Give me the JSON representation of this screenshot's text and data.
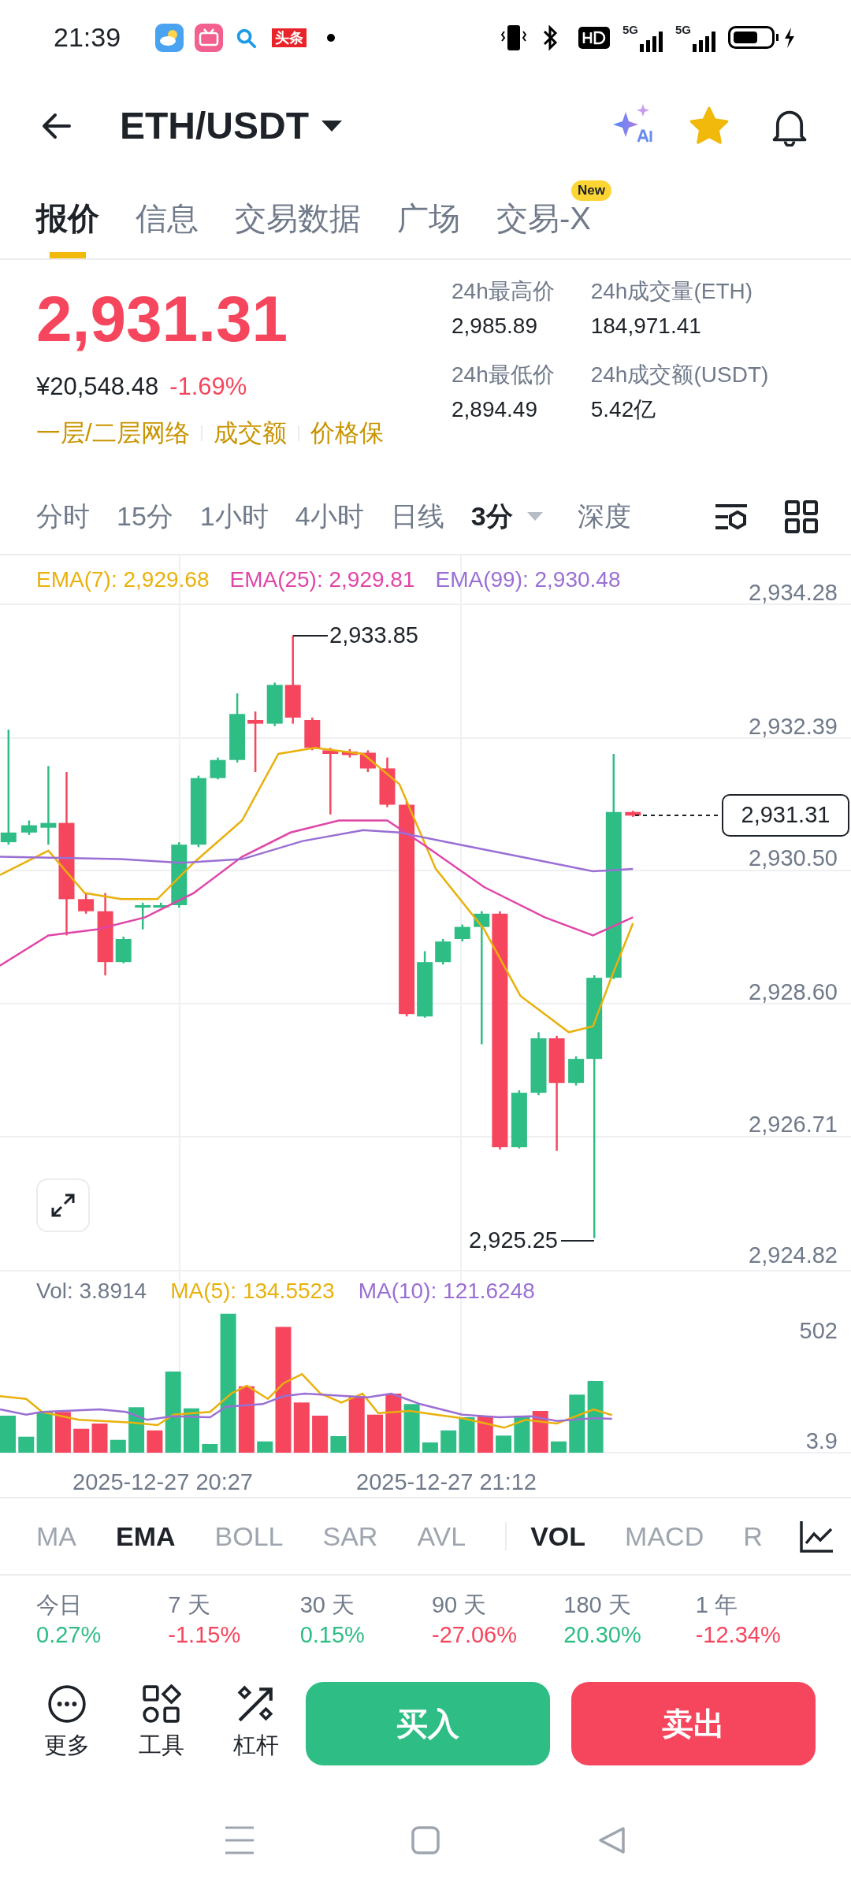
{
  "status_bar": {
    "time": "21:39",
    "news_app": "头条",
    "signals": [
      {
        "network": "5G"
      },
      {
        "network": "5G"
      }
    ]
  },
  "header": {
    "title": "ETH/USDT",
    "favorite": true
  },
  "tabs": [
    {
      "label": "报价",
      "selected": true
    },
    {
      "label": "信息",
      "selected": false
    },
    {
      "label": "交易数据",
      "selected": false
    },
    {
      "label": "广场",
      "selected": false
    },
    {
      "label": "交易-X",
      "selected": false,
      "badge": "New"
    }
  ],
  "price": {
    "last": "2,931.31",
    "fiat": "¥20,548.48",
    "change": "-1.69%",
    "color": "#f6465d",
    "links": [
      "一层/二层网络",
      "成交额",
      "价格保"
    ]
  },
  "stats": [
    {
      "label": "24h最高价",
      "value": "2,985.89"
    },
    {
      "label": "24h成交量(ETH)",
      "value": "184,971.41"
    },
    {
      "label": "24h最低价",
      "value": "2,894.49"
    },
    {
      "label": "24h成交额(USDT)",
      "value": "5.42亿"
    }
  ],
  "intervals": [
    {
      "label": "分时",
      "selected": false
    },
    {
      "label": "15分",
      "selected": false
    },
    {
      "label": "1小时",
      "selected": false
    },
    {
      "label": "4小时",
      "selected": false
    },
    {
      "label": "日线",
      "selected": false
    },
    {
      "label": "3分",
      "selected": true,
      "dropdown": true
    },
    {
      "label": "深度",
      "selected": false
    }
  ],
  "chart": {
    "legend": [
      {
        "text": "EMA(7): 2,929.68",
        "color": "#e8b10c"
      },
      {
        "text": "EMA(25): 2,929.81",
        "color": "#e045a8"
      },
      {
        "text": "EMA(99): 2,930.48",
        "color": "#9a6fd4"
      }
    ],
    "y_axis": [
      "2,934.28",
      "2,932.39",
      "2,930.50",
      "2,928.60",
      "2,926.71",
      "2,924.82"
    ],
    "high_label": "2,933.85",
    "low_label": "2,925.25",
    "last_price": "2,931.31"
  },
  "volume": {
    "legend": [
      {
        "text": "Vol: 3.8914",
        "color": "#707a8a"
      },
      {
        "text": "MA(5): 134.5523",
        "color": "#e8b10c"
      },
      {
        "text": "MA(10): 121.6248",
        "color": "#9a6fd4"
      }
    ],
    "y_axis": [
      "502",
      "3.9"
    ],
    "x_axis": [
      "2025-12-27 20:27",
      "2025-12-27 21:12"
    ]
  },
  "indicators": [
    {
      "label": "MA",
      "selected": false
    },
    {
      "label": "EMA",
      "selected": true
    },
    {
      "label": "BOLL",
      "selected": false
    },
    {
      "label": "SAR",
      "selected": false
    },
    {
      "label": "AVL",
      "selected": false
    },
    {
      "label": "VOL",
      "selected": true,
      "divider_before": true
    },
    {
      "label": "MACD",
      "selected": false
    },
    {
      "label": "R",
      "selected": false
    }
  ],
  "returns": [
    {
      "period": "今日",
      "value": "0.27%",
      "color": "#2ebd85"
    },
    {
      "period": "7 天",
      "value": "-1.15%",
      "color": "#f6465d"
    },
    {
      "period": "30 天",
      "value": "0.15%",
      "color": "#2ebd85"
    },
    {
      "period": "90 天",
      "value": "-27.06%",
      "color": "#f6465d"
    },
    {
      "period": "180 天",
      "value": "20.30%",
      "color": "#2ebd85"
    },
    {
      "period": "1 年",
      "value": "-12.34%",
      "color": "#f6465d"
    }
  ],
  "actions": [
    {
      "label": "更多",
      "kind": "more"
    },
    {
      "label": "工具",
      "kind": "tools"
    },
    {
      "label": "杠杆",
      "kind": "leverage"
    }
  ],
  "trade_buttons": [
    {
      "label": "买入",
      "kind": "buy"
    },
    {
      "label": "卖出",
      "kind": "sell"
    }
  ]
}
